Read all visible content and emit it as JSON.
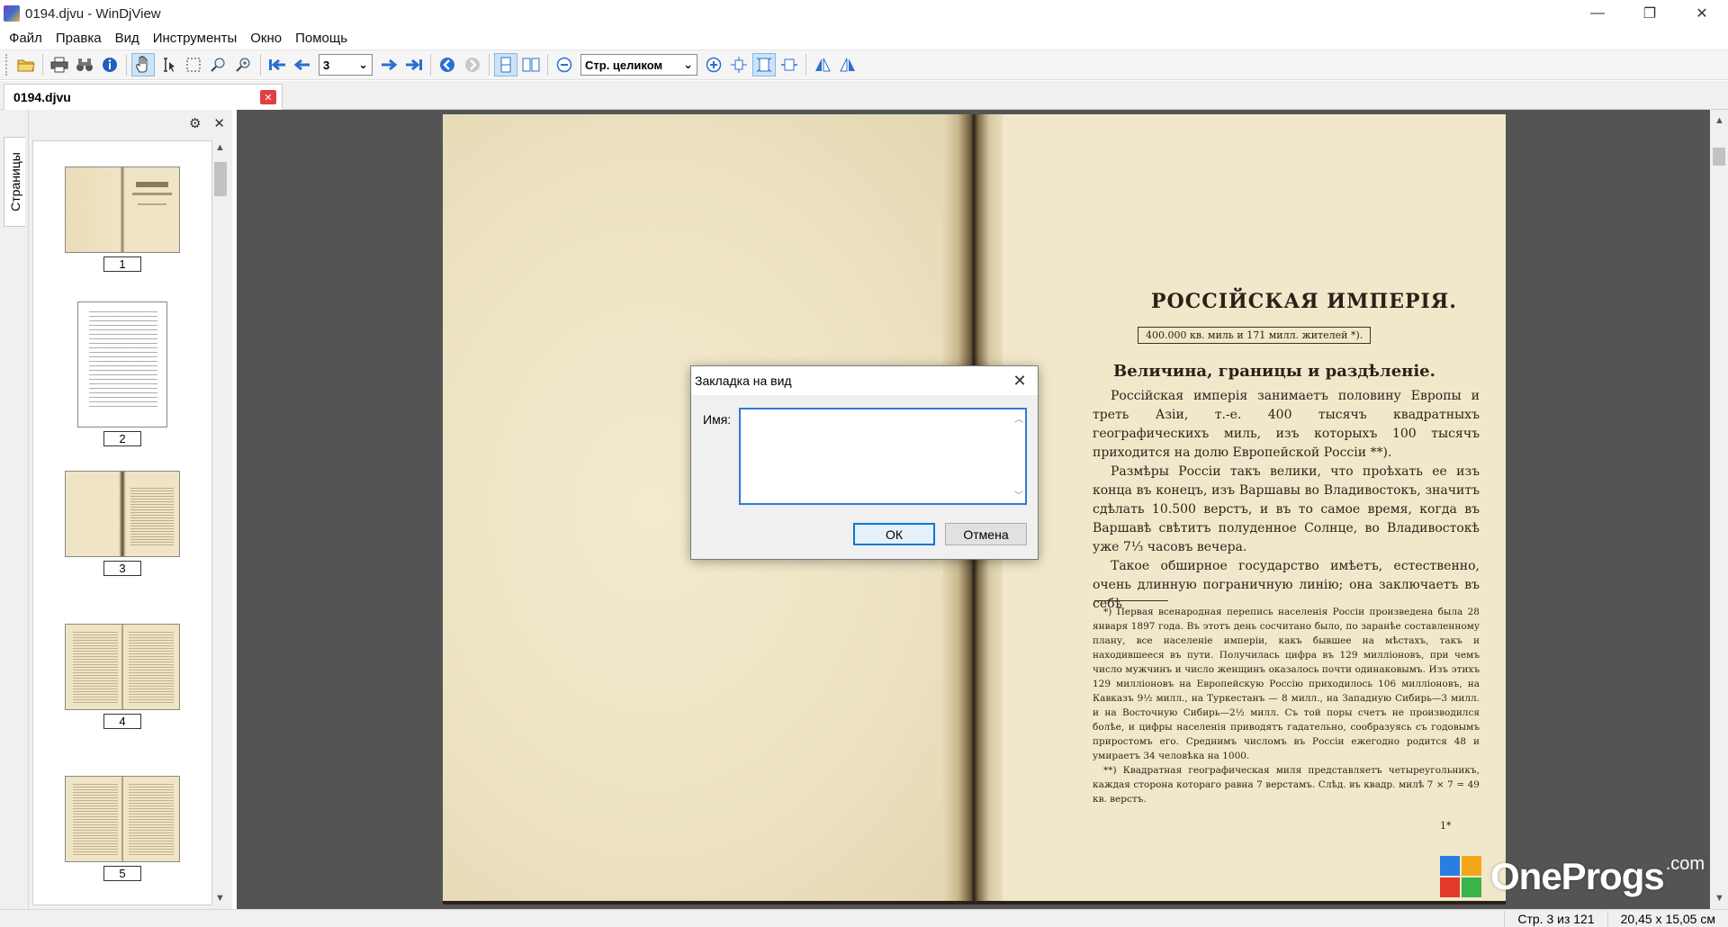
{
  "window": {
    "title": "0194.djvu - WinDjView",
    "controls": [
      "—",
      "❐",
      "✕"
    ]
  },
  "menu": [
    "Файл",
    "Правка",
    "Вид",
    "Инструменты",
    "Окно",
    "Помощь"
  ],
  "toolbar": {
    "page_value": "3",
    "zoom_value": "Стр. целиком"
  },
  "tab": {
    "title": "0194.djvu",
    "close": "✕"
  },
  "sidebar": {
    "tab_label": "Страницы",
    "thumbnails": [
      {
        "label": "1"
      },
      {
        "label": "2"
      },
      {
        "label": "3"
      },
      {
        "label": "4"
      },
      {
        "label": "5"
      }
    ]
  },
  "page": {
    "title": "РОССІЙСКАЯ ИМПЕРІЯ.",
    "subtitle": "400.000 кв. миль и 171 милл. жителей *).",
    "heading": "Величина, границы и раздѣленіе.",
    "paragraphs": [
      "Россійская имперія занимаетъ половину Европы и треть Азіи, т.-е. 400 тысячъ квадратныхъ географическихъ миль, изъ которыхъ 100 тысячъ приходится на долю Европейской Россіи **).",
      "Размѣры Россіи такъ велики, что проѣхать ее изъ конца въ конецъ, изъ Варшавы во Владивостокъ, значитъ сдѣлать 10.500 верстъ, и въ то самое время, когда въ Варшавѣ свѣтитъ полуденное Солнце, во Владивостокѣ уже 7⅓ часовъ вечера.",
      "Такое обширное государство имѣетъ, естественно, очень длинную пограничную линію; она заключаетъ въ себѣ"
    ],
    "footnotes": [
      "*) Первая всенародная перепись населенія Россіи произведена была 28 января 1897 года. Въ этотъ день сосчитано было, по заранѣе составленному плану, все населеніе имперіи, какъ бывшее на мѣстахъ, такъ и находившееся въ пути. Получилась цифра въ 129 милліоновъ, при чемъ число мужчинъ и число женщинъ оказалось почти одинаковымъ. Изъ этихъ 129 милліоновъ на Европейскую Россію приходилось 106 милліоновъ, на Кавказъ 9½ милл., на Туркестанъ — 8 милл., на Западную Сибирь—3 милл. и на Восточную Сибирь—2½ милл. Съ той поры счетъ не производился болѣе, и цифры населенія приводятъ гадательно, сообразуясь съ годовымъ приростомъ его. Среднимъ числомъ въ Россіи ежегодно родится 48 и умираетъ 34 человѣка на 1000.",
      "**) Квадратная географическая миля представляетъ четыреугольникъ, каждая сторона котораго равна 7 верстамъ. Слѣд. въ квадр. милѣ 7 × 7 = 49 кв. верстъ."
    ],
    "page_num": "1*"
  },
  "dialog": {
    "title": "Закладка на вид",
    "name_label": "Имя:",
    "name_value": "",
    "ok_label": "ОК",
    "cancel_label": "Отмена"
  },
  "status": {
    "page_info": "Стр. 3 из 121",
    "page_size": "20,45 x 15,05 см"
  },
  "watermark": {
    "text": "OneProgs",
    "suffix": ".com"
  },
  "colors": {
    "viewer_bg": "#545454",
    "accent": "#0078d7",
    "paper": "#efe6c8"
  }
}
